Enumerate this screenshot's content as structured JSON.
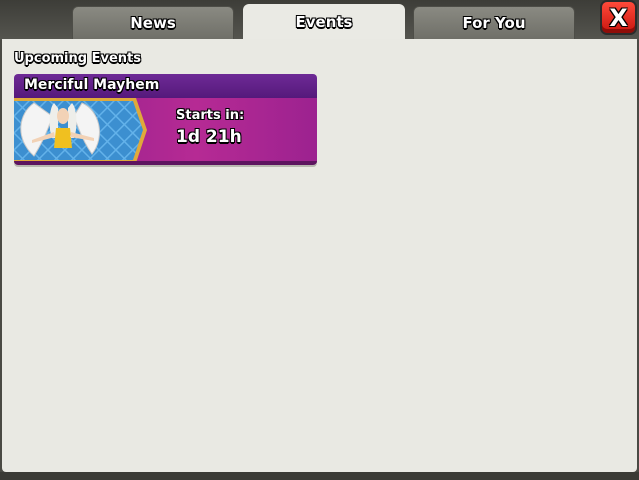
{
  "tabs": [
    {
      "label": "News",
      "active": false
    },
    {
      "label": "Events",
      "active": true
    },
    {
      "label": "For You",
      "active": false
    }
  ],
  "close_button": {
    "label": "X"
  },
  "section_title": "Upcoming Events",
  "events": [
    {
      "name": "Merciful Mayhem",
      "starts_label": "Starts in:",
      "starts_value": "1d 21h",
      "image_icon": "angel-hero-icon"
    }
  ],
  "colors": {
    "accent_purple": "#6e2a96",
    "card_magenta": "#b62a94",
    "close_red": "#e0251a",
    "panel_bg": "#e9e9e3"
  }
}
